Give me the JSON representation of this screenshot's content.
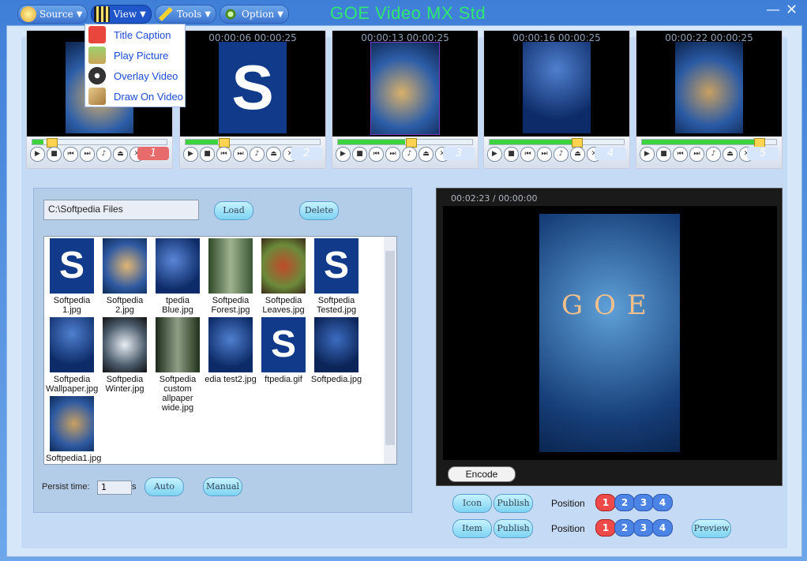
{
  "window": {
    "title": "GOE Video MX Std",
    "minimize": "—",
    "close": "✕"
  },
  "menu": [
    {
      "label": "Source",
      "icon": "source-icon"
    },
    {
      "label": "View",
      "icon": "view-icon"
    },
    {
      "label": "Tools",
      "icon": "tools-icon"
    },
    {
      "label": "Option",
      "icon": "option-icon"
    }
  ],
  "dropdown": [
    {
      "label": "Title Caption",
      "icon": "title-caption-icon"
    },
    {
      "label": "Play Picture",
      "icon": "play-picture-icon"
    },
    {
      "label": "Overlay Video",
      "icon": "overlay-video-icon"
    },
    {
      "label": "Draw On Video",
      "icon": "draw-on-video-icon"
    }
  ],
  "videos": [
    {
      "time": "",
      "num": "1"
    },
    {
      "time": "00:00:06 00:00:25",
      "num": "2"
    },
    {
      "time": "00:00:13 00:00:25",
      "num": "3"
    },
    {
      "time": "00:00:16 00:00:25",
      "num": "4"
    },
    {
      "time": "00:00:22 00:00:25",
      "num": "5"
    }
  ],
  "files_panel": {
    "path": "C:\\Softpedia Files",
    "load": "Load",
    "delete": "Delete",
    "items": [
      {
        "l1": "Softpedia 1.jpg",
        "l2": ""
      },
      {
        "l1": "Softpedia 2.jpg",
        "l2": ""
      },
      {
        "l1": "tpedia Blue.jpg",
        "l2": ""
      },
      {
        "l1": "Softpedia",
        "l2": "Forest.jpg"
      },
      {
        "l1": "Softpedia",
        "l2": "Leaves.jpg"
      },
      {
        "l1": "Softpedia",
        "l2": "Tested.jpg"
      },
      {
        "l1": "Softpedia",
        "l2": "Wallpaper.jpg"
      },
      {
        "l1": "Softpedia",
        "l2": "Winter.jpg"
      },
      {
        "l1": "Softpedia custom",
        "l2": "allpaper wide.jpg"
      },
      {
        "l1": "edia test2.jpg",
        "l2": ""
      },
      {
        "l1": "ftpedia.gif",
        "l2": ""
      },
      {
        "l1": "Softpedia.jpg",
        "l2": ""
      },
      {
        "l1": "Softpedia1.jpg",
        "l2": ""
      }
    ],
    "persist_label": "Persist time:",
    "persist_value": "1",
    "persist_unit": "s",
    "auto": "Auto",
    "manual": "Manual"
  },
  "preview": {
    "time": "00:02:23 / 00:00:00",
    "encode": "Encode",
    "overlay_text": "GOE"
  },
  "bottom": {
    "icon": "Icon",
    "item": "Item",
    "publish": "Publish",
    "position": "Position",
    "preview": "Preview",
    "positions": [
      "1",
      "2",
      "3",
      "4"
    ]
  }
}
